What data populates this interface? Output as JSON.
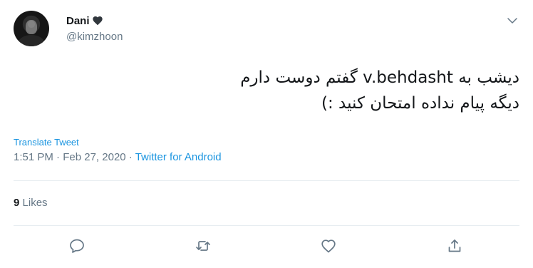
{
  "tweet": {
    "display_name": "Dani",
    "handle": "@kimzhoon",
    "text_line1_rtl_before": "دیشب به",
    "text_line1_ltr": "v.behdasht",
    "text_line1_rtl_after": "گفتم دوست دارم",
    "text_line2": "دیگه پیام نداده امتحان کنید :)",
    "translate_label": "Translate Tweet",
    "time": "1:51 PM",
    "separator": "·",
    "date": "Feb 27, 2020",
    "source": "Twitter for Android",
    "likes_count": "9",
    "likes_label": "Likes"
  },
  "icons": {
    "name_emoji": "black-heart-icon",
    "menu": "chevron-down-icon",
    "reply": "reply-icon",
    "retweet": "retweet-icon",
    "like": "heart-outline-icon",
    "share": "share-icon"
  },
  "colors": {
    "link": "#1b95e0",
    "secondary_text": "#657786",
    "primary_text": "#14171a",
    "divider": "#e6ecf0"
  }
}
